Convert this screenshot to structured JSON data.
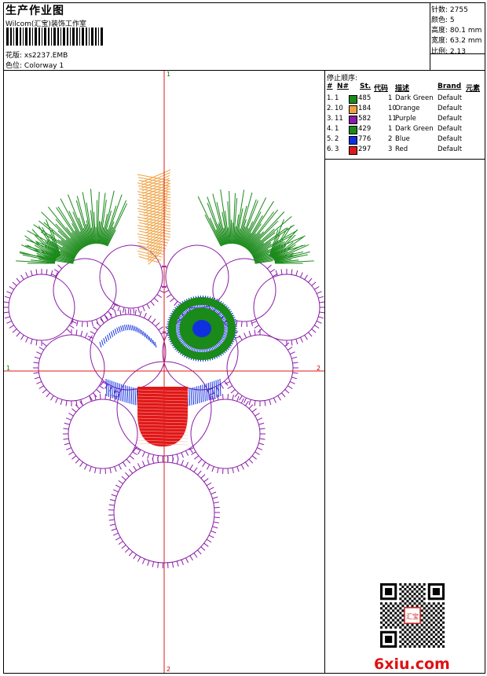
{
  "header": {
    "title": "生产作业图",
    "subtitle": "Wilcom(汇宝)装饰工作室",
    "design_label": "花版:",
    "design_file": "xs2237.EMB",
    "colorway_label": "色位:",
    "colorway": "Colorway 1"
  },
  "stats": [
    {
      "label": "针数:",
      "value": "2755"
    },
    {
      "label": "颜色:",
      "value": "5"
    },
    {
      "label": "高度:",
      "value": "80.1 mm"
    },
    {
      "label": "宽度:",
      "value": "63.2 mm"
    },
    {
      "label": "比例:",
      "value": "2.13"
    }
  ],
  "canvas": {
    "axis_top": "1",
    "axis_bottom": "2",
    "axis_left": "1",
    "axis_right": "2"
  },
  "sequence": {
    "title": "停止顺序:",
    "columns": [
      "#",
      "N#",
      "St.",
      "代码",
      "描述",
      "Brand",
      "元素"
    ],
    "rows": [
      {
        "idx": "1.",
        "n": "1",
        "st": "485",
        "code": "1",
        "desc": "Dark Green",
        "brand": "Default",
        "color": "#1a8a1a"
      },
      {
        "idx": "2.",
        "n": "10",
        "st": "184",
        "code": "10",
        "desc": "Orange",
        "brand": "Default",
        "color": "#f0a040"
      },
      {
        "idx": "3.",
        "n": "11",
        "st": "582",
        "code": "11",
        "desc": "Purple",
        "brand": "Default",
        "color": "#8a1aa8"
      },
      {
        "idx": "4.",
        "n": "1",
        "st": "429",
        "code": "1",
        "desc": "Dark Green",
        "brand": "Default",
        "color": "#1a8a1a"
      },
      {
        "idx": "5.",
        "n": "2",
        "st": "776",
        "code": "2",
        "desc": "Blue",
        "brand": "Default",
        "color": "#1030e0"
      },
      {
        "idx": "6.",
        "n": "3",
        "st": "297",
        "code": "3",
        "desc": "Red",
        "brand": "Default",
        "color": "#e01818"
      }
    ]
  },
  "watermark": "6xiu.com",
  "qr_seal_text": "汇宝"
}
